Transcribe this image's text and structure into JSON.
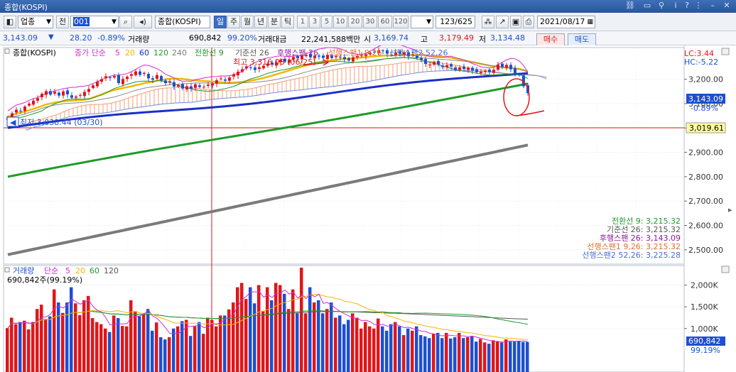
{
  "window": {
    "title": "종합(KOSPI)"
  },
  "colors": {
    "up": "#e0161a",
    "down": "#1d4fd1",
    "ma5": "#d42ad4",
    "ma20": "#f0b800",
    "ma60": "#1b2fc4",
    "ma120": "#1f9a2a",
    "ma240": "#7a7a7a",
    "cloud": "#f2a07a",
    "span2": "#6f8fe0",
    "highlight": "#ffffa0"
  },
  "toolbar": {
    "market_select": "업종",
    "prev_label": "전",
    "code": "001",
    "name": "종합(KOSPI)",
    "periods": [
      "일",
      "주",
      "월",
      "년",
      "분",
      "틱"
    ],
    "active_period": "일",
    "intervals": [
      "1",
      "3",
      "5",
      "10",
      "20",
      "30",
      "60",
      "120"
    ],
    "count": "123/625",
    "date": "2021/08/17"
  },
  "quote": {
    "price": "3,143.09",
    "arrow": "▼",
    "change": "28.20",
    "change_pct": "-0.89%",
    "volume_label": "거래량",
    "volume": "690,842",
    "volume_pct": "99.20%",
    "amount_label": "거래대금",
    "amount": "22,241,588백만",
    "open_label": "시",
    "open": "3,169.74",
    "high_label": "고",
    "high": "3,179.49",
    "low_label": "저",
    "low": "3,134.48",
    "buy_label": "매수",
    "sell_label": "매도"
  },
  "price_panel": {
    "legend_name": "종합(KOSPI)",
    "legend_ma": "종가 단순",
    "ma_periods": [
      "5",
      "20",
      "60",
      "120",
      "240"
    ],
    "ichimoku_legend": [
      "전환선 9",
      "기준선 26",
      "후행스팬 26",
      "선행스팬1 9,26",
      "선행스팬2 52,26"
    ],
    "high_note": "최고 3,316.08 (06/25)",
    "low_note": "최저 3,038.44 (03/30)",
    "lc": "LC:3.44",
    "hc": "HC:-5.22",
    "current_price": "3,143.09",
    "current_pct": "-0.89%",
    "crosshair_value": "3,019.61",
    "ichimoku_values": [
      "전환선 9: 3,215.32",
      "기준선 26: 3,215.32",
      "후행스팬 26: 3,143.09",
      "선행스팬1 9,26: 3,215.32",
      "선행스팬2 52,26: 3,225.28"
    ]
  },
  "volume_panel": {
    "legend_name": "거래량",
    "legend_ma": "단순",
    "ma_periods": [
      "5",
      "20",
      "60",
      "120"
    ],
    "current_note": "690,842주(99.19%)",
    "current_value": "690,842",
    "current_pct": "99.19%"
  },
  "chart_data": {
    "type": "candlestick",
    "y_ticks": [
      "3,200.00",
      "3,100.00",
      "3,000.00",
      "2,900.00",
      "2,800.00",
      "2,700.00",
      "2,600.00",
      "2,500.00"
    ],
    "y_ticks_values": [
      3200,
      3100,
      3000,
      2900,
      2800,
      2700,
      2600,
      2500
    ],
    "ylim": [
      2450,
      3330
    ],
    "volume_ticks": [
      "2,000K",
      "1,500K",
      "1,000K"
    ],
    "volume_ticks_values": [
      2000,
      1500,
      1000
    ],
    "volume_ylim": [
      0,
      2450
    ],
    "n_bars": 123,
    "closes": [
      3045,
      3060,
      3075,
      3070,
      3088,
      3100,
      3112,
      3122,
      3140,
      3151,
      3137,
      3149,
      3133,
      3150,
      3138,
      3124,
      3129,
      3135,
      3148,
      3160,
      3175,
      3190,
      3200,
      3212,
      3207,
      3213,
      3184,
      3201,
      3210,
      3221,
      3232,
      3218,
      3226,
      3204,
      3198,
      3217,
      3195,
      3184,
      3192,
      3170,
      3176,
      3162,
      3171,
      3161,
      3179,
      3168,
      3169,
      3178,
      3182,
      3196,
      3203,
      3194,
      3207,
      3220,
      3231,
      3241,
      3253,
      3248,
      3238,
      3249,
      3255,
      3264,
      3260,
      3270,
      3280,
      3272,
      3281,
      3291,
      3286,
      3295,
      3300,
      3290,
      3297,
      3293,
      3287,
      3300,
      3287,
      3296,
      3291,
      3282,
      3277,
      3290,
      3295,
      3299,
      3303,
      3309,
      3312,
      3318,
      3315,
      3305,
      3299,
      3310,
      3305,
      3311,
      3294,
      3301,
      3287,
      3279,
      3263,
      3260,
      3271,
      3260,
      3250,
      3258,
      3252,
      3238,
      3248,
      3242,
      3247,
      3236,
      3229,
      3230,
      3235,
      3230,
      3239,
      3260,
      3250,
      3259,
      3241,
      3225,
      3216,
      3171,
      3143
    ],
    "volumes": [
      1010,
      1250,
      1100,
      1150,
      1180,
      980,
      1150,
      1450,
      1550,
      1220,
      1280,
      1900,
      1600,
      1360,
      1600,
      1950,
      1580,
      1310,
      1650,
      1750,
      1240,
      1150,
      1100,
      1000,
      920,
      1300,
      1240,
      1060,
      1050,
      1650,
      1400,
      1280,
      1340,
      1450,
      950,
      1140,
      800,
      750,
      800,
      1000,
      1050,
      1170,
      1200,
      830,
      1050,
      1150,
      880,
      1250,
      1200,
      1050,
      1300,
      1300,
      1440,
      1600,
      1950,
      2050,
      1680,
      1950,
      1580,
      2000,
      1400,
      1950,
      1650,
      2050,
      2000,
      1800,
      1450,
      1900,
      1350,
      2400,
      1350,
      1950,
      1600,
      1650,
      1350,
      1450,
      1600,
      1250,
      1300,
      1100,
      1200,
      1350,
      1250,
      1000,
      1150,
      1050,
      1000,
      1230,
      1050,
      950,
      1100,
      1150,
      1050,
      850,
      1000,
      950,
      1050,
      850,
      820,
      780,
      880,
      900,
      780,
      900,
      770,
      800,
      900,
      780,
      800,
      830,
      700,
      760,
      680,
      650,
      730,
      700,
      680,
      750,
      700,
      700,
      720,
      690,
      690
    ],
    "ma60_start": 3000,
    "ma60_end": 3230,
    "ma120_start": 2800,
    "ma120_end": 3180,
    "ma240_start": 2480,
    "ma240_end": 2930
  }
}
